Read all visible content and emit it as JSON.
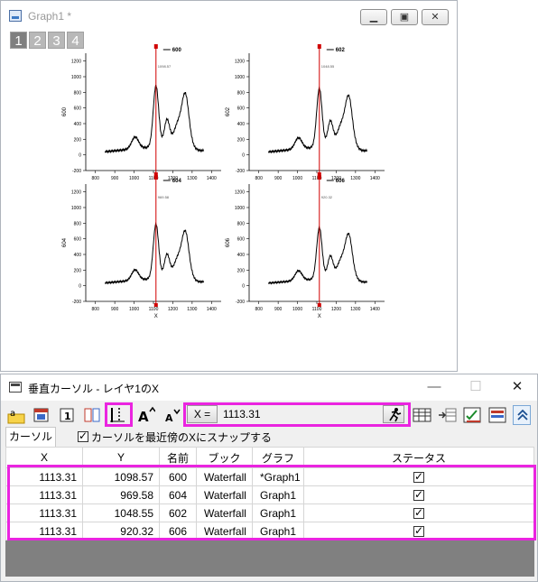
{
  "graph_window": {
    "title": "Graph1 *",
    "layer_tabs": [
      "1",
      "2",
      "3",
      "4"
    ],
    "active_layer": "1"
  },
  "plots": [
    {
      "name": "600",
      "value_label": "1098.57",
      "ylabel": "600"
    },
    {
      "name": "602",
      "value_label": "1048.55",
      "ylabel": "602"
    },
    {
      "name": "604",
      "value_label": "969.58",
      "ylabel": "604"
    },
    {
      "name": "606",
      "value_label": "920.32",
      "ylabel": "606"
    }
  ],
  "plot_axes": {
    "xlabel": "X",
    "xticks": [
      "800",
      "900",
      "1000",
      "1100",
      "1200",
      "1300",
      "1400"
    ],
    "yticks": [
      "-200",
      "0",
      "200",
      "400",
      "600",
      "800",
      "1000",
      "1200"
    ]
  },
  "cursor_window": {
    "title": "垂直カーソル - レイヤ1のX",
    "min_glyph": "—",
    "max_glyph": "☐",
    "close_glyph": "✕",
    "x_button_label": "X =",
    "x_value": "1113.31",
    "tab_label": "カーソル",
    "snap_label": "カーソルを最近傍のXにスナップする",
    "snap_checked": true,
    "columns": [
      "X",
      "Y",
      "名前",
      "ブック",
      "グラフ",
      "ステータス"
    ],
    "rows": [
      {
        "x": "1113.31",
        "y": "1098.57",
        "name": "600",
        "book": "Waterfall",
        "graph": "*Graph1",
        "status": true
      },
      {
        "x": "1113.31",
        "y": "969.58",
        "name": "604",
        "book": "Waterfall",
        "graph": "Graph1",
        "status": true
      },
      {
        "x": "1113.31",
        "y": "1048.55",
        "name": "602",
        "book": "Waterfall",
        "graph": "Graph1",
        "status": true
      },
      {
        "x": "1113.31",
        "y": "920.32",
        "name": "606",
        "book": "Waterfall",
        "graph": "Graph1",
        "status": true
      }
    ]
  },
  "colors": {
    "highlight": "#ea24e0",
    "cursor_line": "#d00000",
    "grid_empty": "#808080"
  }
}
